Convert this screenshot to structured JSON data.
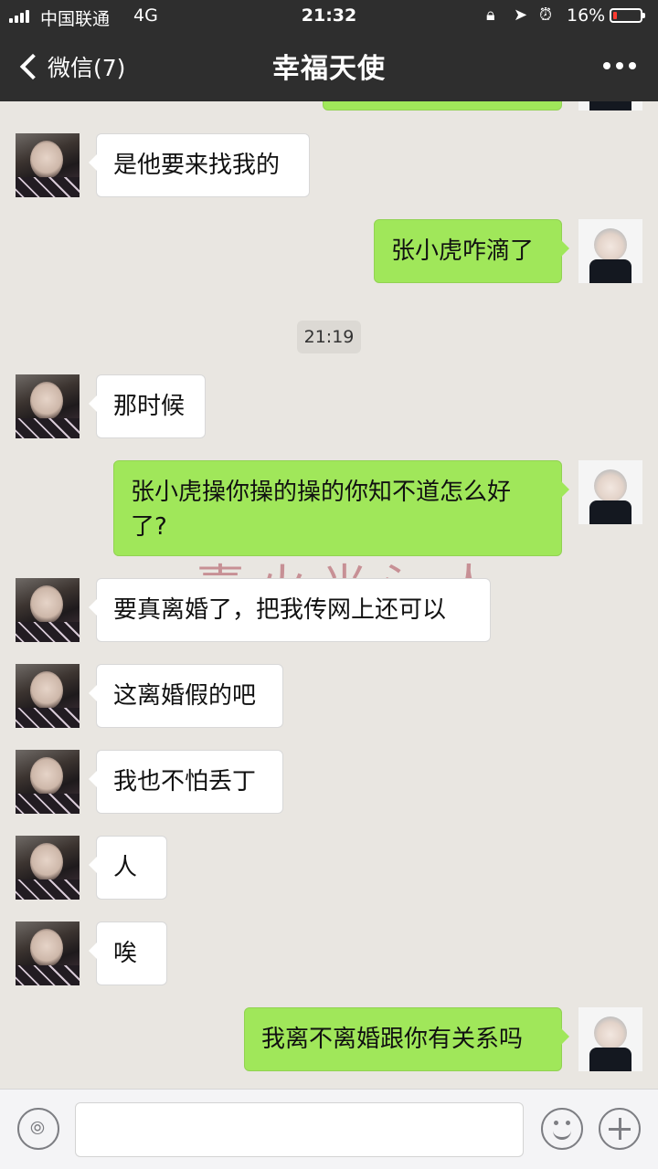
{
  "status_bar": {
    "carrier": "中国联通",
    "network": "4G",
    "time": "21:32",
    "battery_percent": "16%",
    "battery_level": 0.16,
    "icons": [
      "signal-icon",
      "orientation-lock-icon",
      "location-arrow-icon",
      "alarm-icon",
      "battery-icon"
    ]
  },
  "nav": {
    "back_label": "微信(7)",
    "title": "幸福天使",
    "more_icon": "more-dots-icon"
  },
  "chat": {
    "messages": [
      {
        "sender": "them",
        "text": "是他要来找我的"
      },
      {
        "sender": "me",
        "text": "张小虎咋滴了"
      },
      {
        "sender": "them",
        "text": "那时候"
      },
      {
        "sender": "me",
        "text": "张小虎操你操的操的你知不道怎么好了?"
      },
      {
        "sender": "them",
        "text": "要真离婚了，把我传网上还可以"
      },
      {
        "sender": "them",
        "text": "这离婚假的吧"
      },
      {
        "sender": "them",
        "text": "我也不怕丢丁"
      },
      {
        "sender": "them",
        "text": "人"
      },
      {
        "sender": "them",
        "text": "唉"
      },
      {
        "sender": "me",
        "text": "我离不离婚跟你有关系吗"
      }
    ],
    "timestamp": "21:19"
  },
  "input_bar": {
    "voice_icon": "voice-icon",
    "emoji_icon": "emoji-icon",
    "plus_icon": "plus-icon",
    "input_value": ""
  },
  "colors": {
    "nav_bg": "#2e2e2e",
    "chat_bg": "#e9e6e1",
    "bubble_me": "#a0e75a",
    "bubble_them": "#ffffff",
    "battery_low": "#ff3b30"
  }
}
